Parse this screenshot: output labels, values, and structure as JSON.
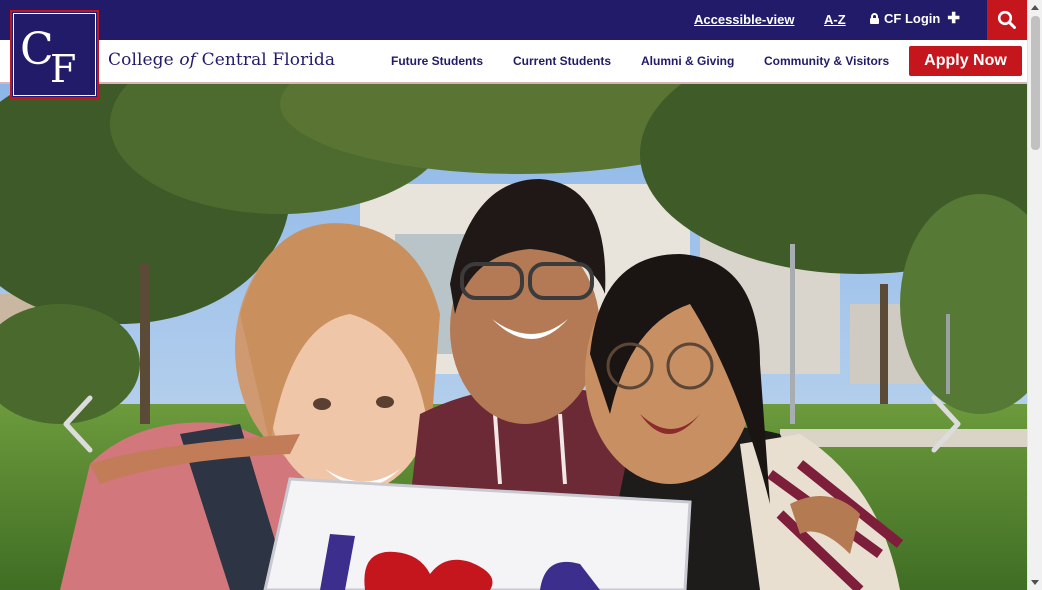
{
  "brand": {
    "logo_monogram": "CF",
    "name_part1": "College",
    "name_part2": "of",
    "name_part3": "Central Florida",
    "primary_color": "#221b69",
    "accent_color": "#c4161c"
  },
  "utility_bar": {
    "accessible_label": "Accessible-view",
    "az_label": "A-Z",
    "login_label": "CF Login",
    "login_icon": "lock-icon",
    "login_expand_icon": "plus-icon",
    "search_icon": "search-icon"
  },
  "nav": {
    "items": [
      {
        "label": "Future Students"
      },
      {
        "label": "Current Students"
      },
      {
        "label": "Alumni & Giving"
      },
      {
        "label": "Community & Visitors"
      }
    ],
    "apply_label": "Apply Now"
  },
  "hero": {
    "slide_image": "three smiling students outdoors on campus holding a sign",
    "prev_icon": "chevron-left-icon",
    "next_icon": "chevron-right-icon"
  }
}
